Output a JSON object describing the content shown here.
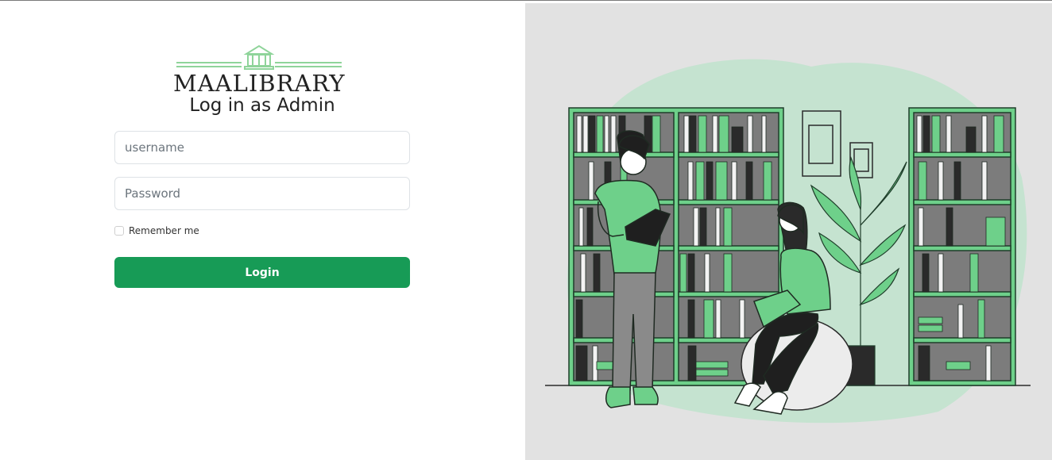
{
  "brand": {
    "name": "MAALIBRARY"
  },
  "login": {
    "title": "Log in as Admin",
    "username_placeholder": "username",
    "password_placeholder": "Password",
    "remember_label": "Remember me",
    "submit_label": "Login"
  },
  "colors": {
    "accent": "#179b56",
    "illustration_green": "#6ed08a",
    "panel_bg": "#e2e2e2",
    "blob": "#c5e3d0"
  }
}
